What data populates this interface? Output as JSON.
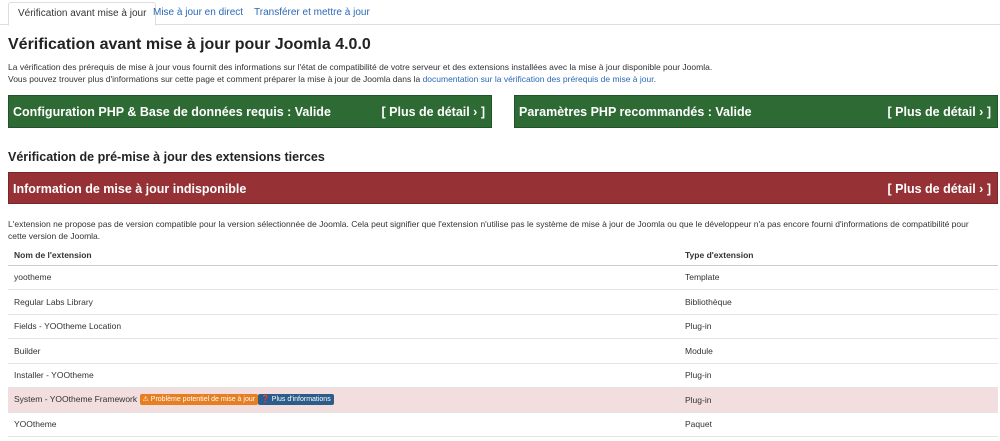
{
  "tabs": [
    {
      "label": "Vérification avant mise à jour"
    },
    {
      "label": "Mise à jour en direct"
    },
    {
      "label": "Transférer et mettre à jour"
    }
  ],
  "page": {
    "title": "Vérification avant mise à jour pour Joomla 4.0.0",
    "intro_line1": "La vérification des prérequis de mise à jour vous fournit des informations sur l'état de compatibilité de votre serveur et des extensions installées avec la mise à jour disponible pour Joomla.",
    "intro_line2_prefix": "Vous pouvez trouver plus d'informations sur cette page et comment préparer la mise à jour de Joomla dans la ",
    "intro_link": "documentation sur la vérification des prérequis de mise à jour",
    "intro_line2_suffix": "."
  },
  "panels": {
    "php_db": {
      "label": "Configuration PHP & Base de données requis : Valide",
      "more": "[ Plus de détail ›  ]"
    },
    "php_recommended": {
      "label": "Paramètres PHP recommandés : Valide",
      "more": "[ Plus de détail ›  ]"
    },
    "update_info": {
      "label": "Information de mise à jour indisponible",
      "more": "[ Plus de détail ›  ]"
    }
  },
  "extensions_section": {
    "heading": "Vérification de pré-mise à jour des extensions tierces",
    "description": "L'extension ne propose pas de version compatible pour la version sélectionnée de Joomla. Cela peut signifier que l'extension n'utilise pas le système de mise à jour de Joomla ou que le développeur n'a pas encore fourni d'informations de compatibilité pour cette version de Joomla.",
    "columns": [
      "Nom de l'extension",
      "Type d'extension"
    ],
    "rows": [
      {
        "name": "yootheme",
        "type": "Template"
      },
      {
        "name": "Regular Labs Library",
        "type": "Bibliothèque"
      },
      {
        "name": "Fields - YOOtheme Location",
        "type": "Plug-in"
      },
      {
        "name": "Builder",
        "type": "Module"
      },
      {
        "name": "Installer - YOOtheme",
        "type": "Plug-in"
      },
      {
        "name": "System - YOOtheme Framework",
        "type": "Plug-in",
        "badge_warning": "Problème potentiel de mise à jour",
        "badge_info": "Plus d'informations"
      },
      {
        "name": "YOOtheme",
        "type": "Paquet"
      }
    ]
  },
  "colors": {
    "success": "#2e6a33",
    "danger": "#963235",
    "link": "#2a69b8",
    "warning_badge": "#e67e22",
    "info_badge": "#2c5d8a",
    "warning_row": "#f2dede"
  }
}
